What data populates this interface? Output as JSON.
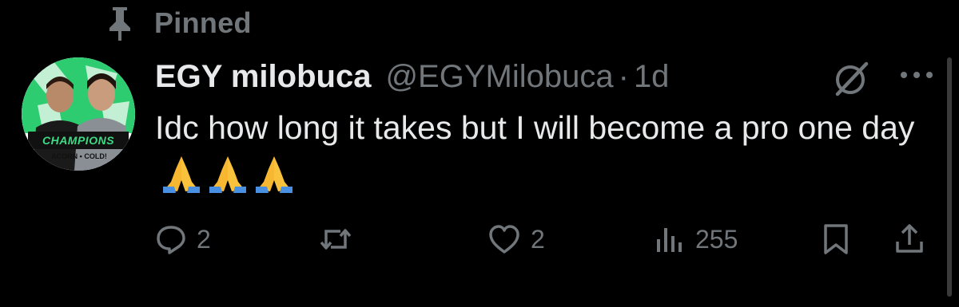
{
  "pinned": {
    "label": "Pinned",
    "icon": "pin-icon"
  },
  "author": {
    "display_name": "EGY milobuca",
    "handle": "@EGYMilobuca",
    "separator": "·",
    "time": "1d",
    "avatar_banner": "CHAMPIONS",
    "avatar_sub": "ACORN • COLD!"
  },
  "tweet": {
    "text": "Idc how long it takes but I will become a pro one day",
    "emojis": [
      "folded-hands",
      "folded-hands",
      "folded-hands"
    ]
  },
  "actions": {
    "reply_count": "2",
    "like_count": "2",
    "view_count": "255"
  },
  "colors": {
    "background": "#000000",
    "primary_text": "#e7e9ea",
    "secondary_text": "#71767b"
  }
}
